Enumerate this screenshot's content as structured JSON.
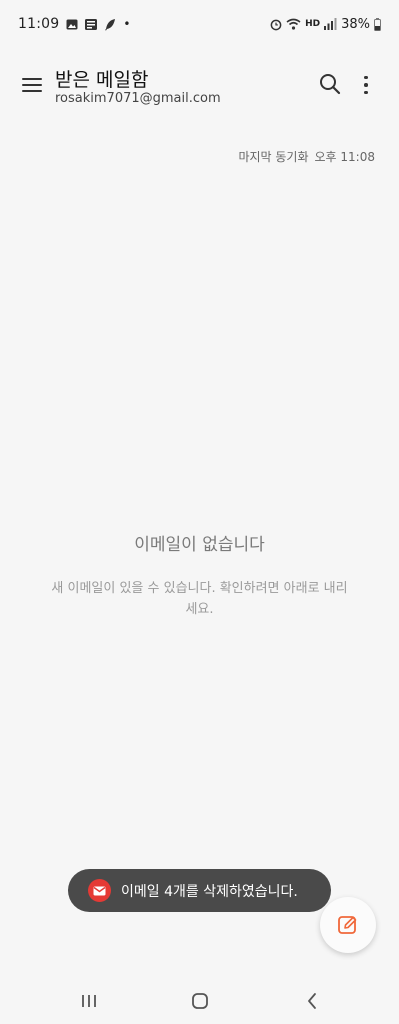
{
  "status_bar": {
    "time": "11:09",
    "dot": "•",
    "network_label": "HD",
    "battery": "38%",
    "left_icons": [
      "image-icon",
      "list-icon",
      "feather-icon"
    ],
    "right_icons": [
      "alarm-icon",
      "wifi-icon",
      "signal-icon",
      "battery-icon"
    ]
  },
  "header": {
    "title": "받은 메일함",
    "account": "rosakim7071@gmail.com",
    "icons": [
      "menu-icon",
      "search-icon",
      "more-vert-icon"
    ]
  },
  "sync": {
    "label": "마지막 동기화",
    "time": "오후 11:08"
  },
  "empty_state": {
    "title": "이메일이 없습니다",
    "description": "새 이메일이 있을 수 있습니다. 확인하려면 아래로 내리세요."
  },
  "toast": {
    "message": "이메일 4개를 삭제하였습니다.",
    "icon": "mail-icon",
    "icon_color": "#e53a35"
  },
  "fab": {
    "icon": "compose-icon",
    "accent": "#f0683a"
  },
  "nav_bar": {
    "icons": [
      "recents-icon",
      "home-icon",
      "back-icon"
    ]
  }
}
